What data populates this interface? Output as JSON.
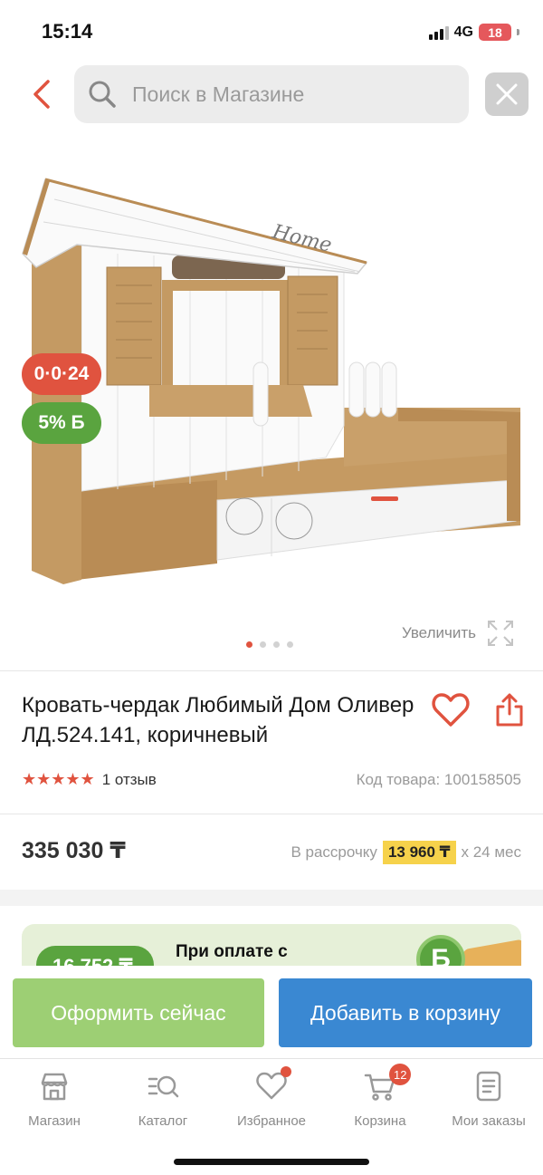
{
  "status_bar": {
    "time": "15:14",
    "network": "4G",
    "battery": "18"
  },
  "header": {
    "search_placeholder": "Поиск в Магазине"
  },
  "gallery": {
    "badges": {
      "installment": "0·0·24",
      "bonus": "5% Б"
    },
    "zoom_label": "Увеличить",
    "image_count": 4,
    "active_index": 0,
    "image_graphic_text": "Home"
  },
  "product": {
    "title": "Кровать-чердак Любимый Дом Оливер ЛД.524.141, коричневый",
    "rating_stars": 5,
    "reviews": "1 отзыв",
    "sku": "Код товара: 100158505",
    "price": "335 030 ₸",
    "installment_prefix": "В рассрочку",
    "installment_amount": "13 960 ₸",
    "installment_suffix": "х 24 мес"
  },
  "promo": {
    "amount": "16 752 ₸",
    "text": "При оплате с",
    "coin_letter": "Б"
  },
  "actions": {
    "buy_now": "Оформить сейчас",
    "add_to_cart": "Добавить в корзину"
  },
  "nav": {
    "items": [
      {
        "label": "Магазин",
        "icon": "store-icon"
      },
      {
        "label": "Каталог",
        "icon": "catalog-search-icon"
      },
      {
        "label": "Избранное",
        "icon": "heart-icon"
      },
      {
        "label": "Корзина",
        "icon": "cart-icon"
      },
      {
        "label": "Мои заказы",
        "icon": "orders-icon"
      }
    ],
    "cart_count": "12"
  },
  "colors": {
    "accent_red": "#e0533f",
    "green": "#5aa43f",
    "blue": "#3a88d2",
    "light_green": "#9dcf74",
    "yellow": "#f6d24b"
  }
}
